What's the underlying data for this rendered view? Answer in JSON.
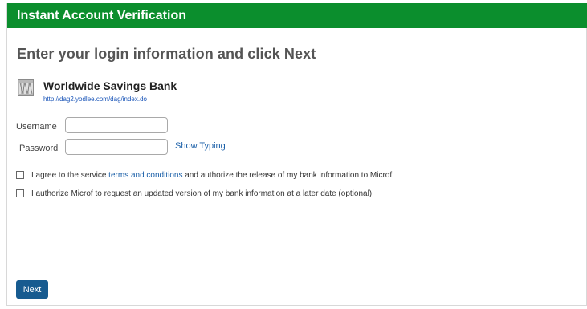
{
  "header": {
    "title": "Instant Account Verification"
  },
  "page": {
    "heading": "Enter your login information and click Next"
  },
  "bank": {
    "name": "Worldwide Savings Bank",
    "url": "http://dag2.yodlee.com/dag/index.do"
  },
  "form": {
    "username_label": "Username",
    "username_value": "",
    "password_label": "Password",
    "password_value": "",
    "show_typing_label": "Show Typing"
  },
  "agreements": {
    "terms_prefix": "I agree to the service ",
    "terms_link": "terms and conditions",
    "terms_suffix": " and authorize the release of my bank information to Microf.",
    "terms_checked": false,
    "update_text": "I authorize Microf to request an updated version of my bank information at a later date (optional).",
    "update_checked": false
  },
  "actions": {
    "next_label": "Next"
  },
  "colors": {
    "header": "#0b8e2d",
    "button": "#175b90",
    "link": "#1a5fa8"
  }
}
